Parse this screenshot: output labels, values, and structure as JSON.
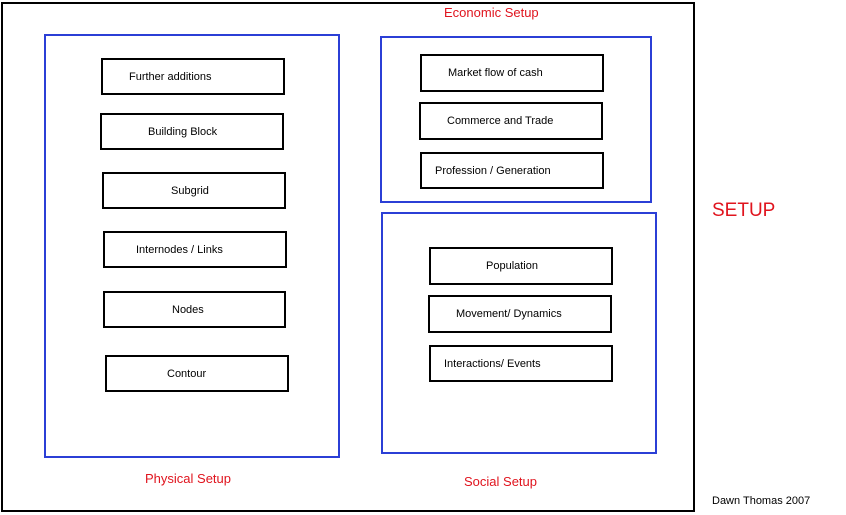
{
  "title": "SETUP",
  "credit": "Dawn Thomas 2007",
  "physical": {
    "label": "Physical Setup",
    "items": [
      "Further additions",
      "Building Block",
      "Subgrid",
      "Internodes / Links",
      "Nodes",
      "Contour"
    ]
  },
  "economic": {
    "label": "Economic Setup",
    "items": [
      "Market flow of cash",
      "Commerce and Trade",
      "Profession / Generation"
    ]
  },
  "social": {
    "label": "Social Setup",
    "items": [
      "Population",
      "Movement/ Dynamics",
      "Interactions/ Events"
    ]
  },
  "colors": {
    "group_border": "#2b3fd6",
    "label_text": "#e0141e",
    "box_border": "#000000"
  }
}
